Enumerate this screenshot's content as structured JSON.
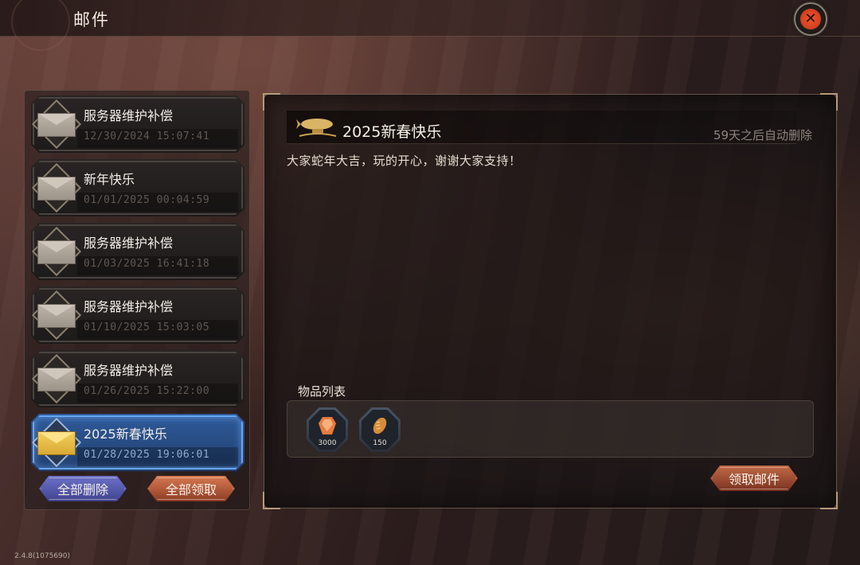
{
  "header": {
    "title": "邮件",
    "close_icon": "close-icon"
  },
  "mail_list": [
    {
      "title": "服务器维护补偿",
      "date": "12/30/2024 15:07:41",
      "icon": "envelope-open-icon",
      "selected": false
    },
    {
      "title": "新年快乐",
      "date": "01/01/2025 00:04:59",
      "icon": "envelope-open-icon",
      "selected": false
    },
    {
      "title": "服务器维护补偿",
      "date": "01/03/2025 16:41:18",
      "icon": "envelope-open-icon",
      "selected": false
    },
    {
      "title": "服务器维护补偿",
      "date": "01/10/2025 15:03:05",
      "icon": "envelope-open-icon",
      "selected": false
    },
    {
      "title": "服务器维护补偿",
      "date": "01/26/2025 15:22:00",
      "icon": "envelope-open-icon",
      "selected": false
    },
    {
      "title": "2025新春快乐",
      "date": "01/28/2025 19:06:01",
      "icon": "envelope-gold-icon",
      "selected": true
    }
  ],
  "list_actions": {
    "delete_all": "全部删除",
    "claim_all": "全部领取"
  },
  "detail": {
    "title": "2025新春快乐",
    "expire": "59天之后自动删除",
    "body": "大家蛇年大吉，玩的开心，谢谢大家支持！",
    "items_label": "物品列表",
    "items": [
      {
        "icon": "gem-icon",
        "qty": "3000"
      },
      {
        "icon": "bread-icon",
        "qty": "150"
      }
    ],
    "claim_button": "领取邮件"
  },
  "version": "2.4.8(1075690)",
  "colors": {
    "selected_mail": "#2f5b9a",
    "delete_button": "#5b5fb0",
    "claim_button": "#b25a3b",
    "close_button": "#e0451f"
  }
}
